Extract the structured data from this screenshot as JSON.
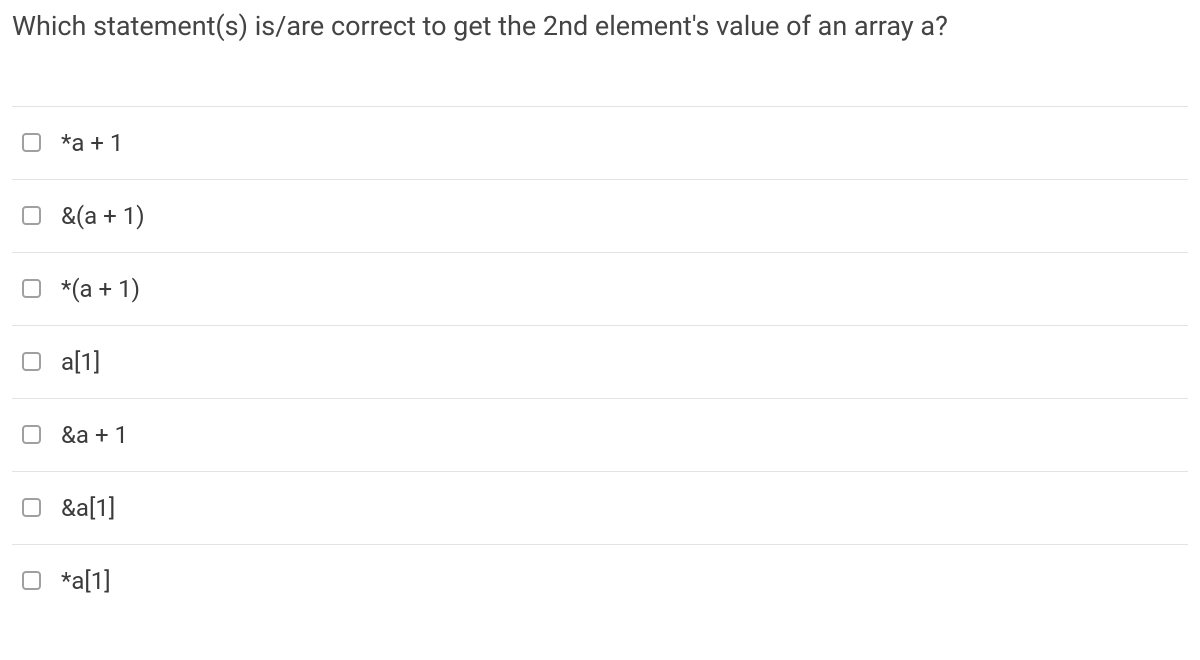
{
  "question": {
    "prompt": "Which statement(s) is/are correct to get the 2nd element's value of an array a?",
    "options": [
      {
        "label": "*a + 1"
      },
      {
        "label": "&(a + 1)"
      },
      {
        "label": "*(a + 1)"
      },
      {
        "label": "a[1]"
      },
      {
        "label": "&a + 1"
      },
      {
        "label": "&a[1]"
      },
      {
        "label": "*a[1]"
      }
    ]
  }
}
